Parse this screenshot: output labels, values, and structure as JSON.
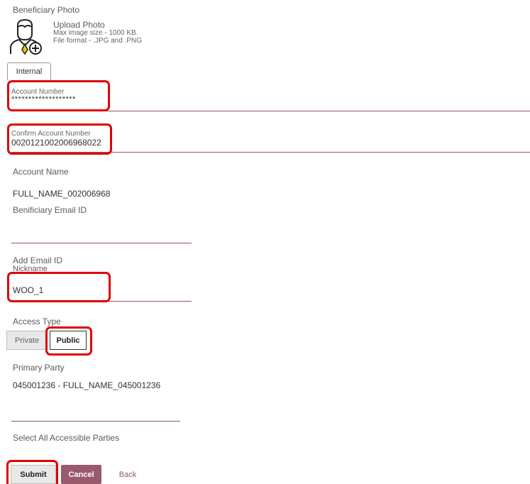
{
  "photo": {
    "section_label": "Beneficiary Photo",
    "upload_label": "Upload Photo",
    "max_size": "Max image size - 1000 KB.",
    "formats": "File format - .JPG and .PNG",
    "icon": "avatar-upload-icon"
  },
  "tabs": {
    "internal_label": "Internal"
  },
  "form": {
    "account_number": {
      "label": "Account Number",
      "value": "*******************"
    },
    "confirm_account_number": {
      "label": "Confirm Account Number",
      "value": "0020121002006968022"
    },
    "account_name": {
      "label": "Account Name",
      "value": "FULL_NAME_002006968"
    },
    "beneficiary_email": {
      "label": "Benificiary Email ID",
      "value": ""
    },
    "add_email_link": "Add Email ID",
    "nickname": {
      "label": "Nickname",
      "value": "WOO_1"
    },
    "access_type": {
      "label": "Access Type",
      "options": [
        "Private",
        "Public"
      ],
      "selected": "Public"
    },
    "primary_party": {
      "label": "Primary Party",
      "value": "045001236 - FULL_NAME_045001236"
    },
    "select_all_label": "Select All Accessible Parties"
  },
  "actions": {
    "submit": "Submit",
    "cancel": "Cancel",
    "back": "Back"
  },
  "colors": {
    "highlight": "#e00000",
    "cancel_bg": "#9a5a6e",
    "underline": "#8a5a66"
  }
}
